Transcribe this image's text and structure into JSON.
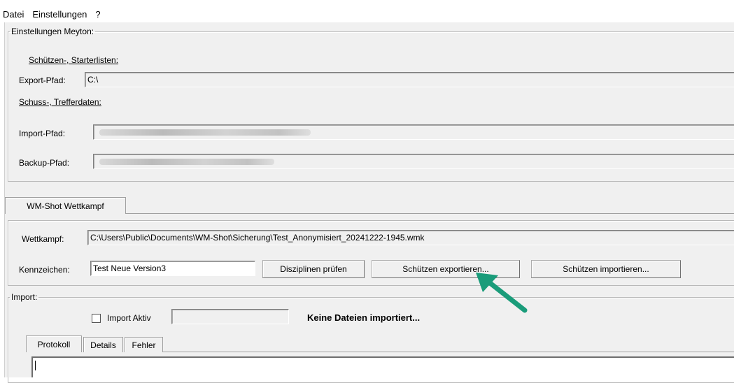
{
  "menu": {
    "items": [
      "Datei",
      "Einstellungen",
      "?"
    ]
  },
  "settings": {
    "legend": "Einstellungen Meyton:",
    "shooter_lists_heading": "Schützen-, Starterlisten:",
    "export_label": "Export-Pfad:",
    "export_value": "C:\\",
    "shot_data_heading": "Schuss-, Trefferdaten:",
    "import_label": "Import-Pfad:",
    "backup_label": "Backup-Pfad:"
  },
  "competition_tab": {
    "label": "WM-Shot Wettkampf"
  },
  "competition": {
    "file_label": "Wettkampf:",
    "file_value": "C:\\Users\\Public\\Documents\\WM-Shot\\Sicherung\\Test_Anonymisiert_20241222-1945.wmk",
    "tag_label": "Kennzeichen:",
    "tag_value": "Test Neue Version3",
    "check_button": "Disziplinen prüfen",
    "export_button": "Schützen exportieren...",
    "import_button": "Schützen importieren..."
  },
  "import": {
    "legend": "Import:",
    "active_label": "Import Aktiv",
    "status": "Keine Dateien importiert...",
    "tabs": [
      "Protokoll",
      "Details",
      "Fehler"
    ]
  },
  "colors": {
    "arrow": "#1a9c7a",
    "window_bg": "#f0f0f0"
  },
  "icons": {
    "annotation_arrow": "arrow-pointing-up-left"
  }
}
